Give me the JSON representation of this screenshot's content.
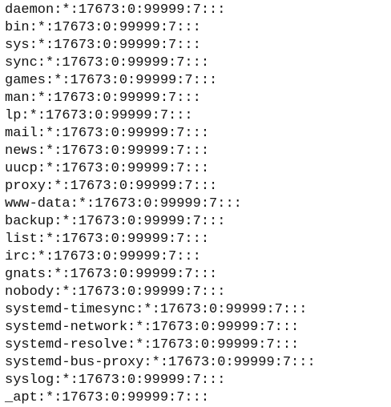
{
  "lines": [
    "daemon:*:17673:0:99999:7:::",
    "bin:*:17673:0:99999:7:::",
    "sys:*:17673:0:99999:7:::",
    "sync:*:17673:0:99999:7:::",
    "games:*:17673:0:99999:7:::",
    "man:*:17673:0:99999:7:::",
    "lp:*:17673:0:99999:7:::",
    "mail:*:17673:0:99999:7:::",
    "news:*:17673:0:99999:7:::",
    "uucp:*:17673:0:99999:7:::",
    "proxy:*:17673:0:99999:7:::",
    "www-data:*:17673:0:99999:7:::",
    "backup:*:17673:0:99999:7:::",
    "list:*:17673:0:99999:7:::",
    "irc:*:17673:0:99999:7:::",
    "gnats:*:17673:0:99999:7:::",
    "nobody:*:17673:0:99999:7:::",
    "systemd-timesync:*:17673:0:99999:7:::",
    "systemd-network:*:17673:0:99999:7:::",
    "systemd-resolve:*:17673:0:99999:7:::",
    "systemd-bus-proxy:*:17673:0:99999:7:::",
    "syslog:*:17673:0:99999:7:::",
    "_apt:*:17673:0:99999:7:::"
  ],
  "colors": {
    "background": "#ffffff",
    "text": "#111111"
  }
}
